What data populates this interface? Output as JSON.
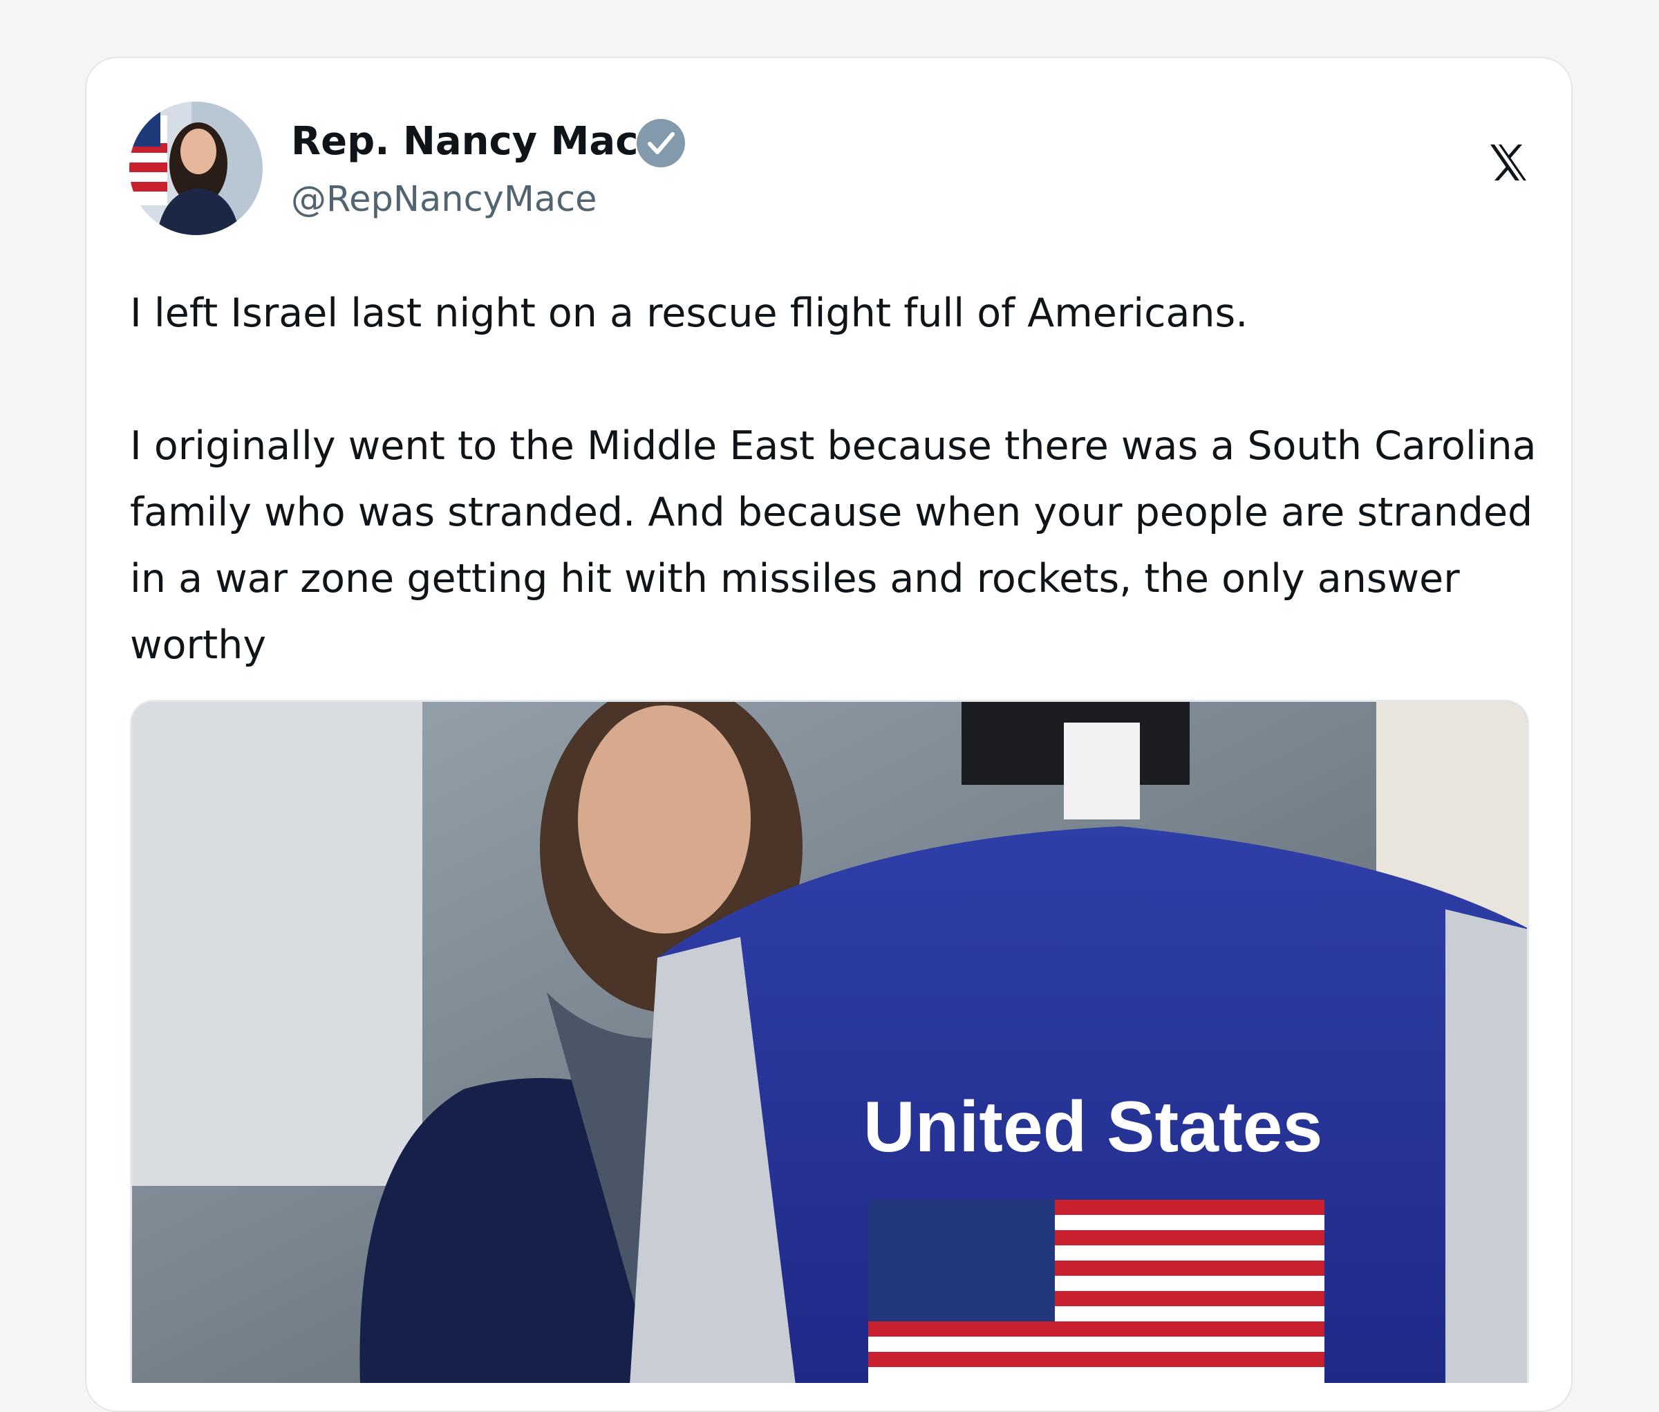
{
  "author": {
    "display_name": "Rep. Nancy Mace",
    "handle": "@RepNancyMace",
    "verified": true,
    "avatar_icon": "avatar-portrait-with-flag"
  },
  "platform_icon": "x-logo-icon",
  "tweet": {
    "text": "I left Israel last night on a rescue flight full of Americans.\n\nI originally went to the Middle East because there was a South Carolina family who was stranded. And because when your people are stranded in a war zone getting hit with missiles and rockets, the only answer worthy"
  },
  "media": {
    "vest_text": "United States"
  },
  "colors": {
    "background": "#f4f5f5",
    "card": "#ffffff",
    "text": "#0f1419",
    "secondary_text": "#536471",
    "verified_badge": "#829aab"
  }
}
